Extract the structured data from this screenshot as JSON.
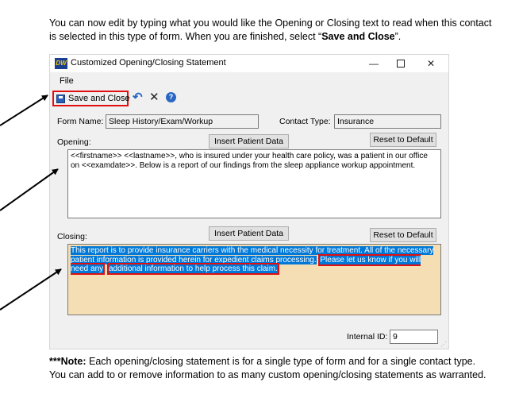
{
  "intro": {
    "part1": "You can now edit by typing what you would like the Opening or Closing text to read when this contact is selected in this type of form. When you are finished, select “",
    "bold": "Save and Close",
    "part2": "”."
  },
  "window": {
    "icon_text": "DW",
    "title": "Customized Opening/Closing Statement",
    "controls": {
      "minimize": "—",
      "close": "✕"
    }
  },
  "menu": {
    "file": "File"
  },
  "toolbar": {
    "save_label": "Save and Close",
    "icons": [
      "save-icon",
      "undo-icon",
      "cancel-icon",
      "help-icon"
    ]
  },
  "form": {
    "form_name_label": "Form Name:",
    "form_name_value": "Sleep History/Exam/Workup",
    "contact_type_label": "Contact Type:",
    "contact_type_value": "Insurance",
    "opening_label": "Opening:",
    "closing_label": "Closing:",
    "insert_patient_data": "Insert Patient Data",
    "reset_to_default": "Reset to Default",
    "opening_text": "<<firstname>> <<lastname>>, who is insured under your health care policy, was a patient in our office on <<examdate>>. Below is a report of our findings from the sleep appliance workup appointment.",
    "closing_text_part1": "This report is to provide insurance carriers with the medical necessity for treatment. All of the necessary patient information is provided herein for expedient claims processing.",
    "closing_text_highlight1": "Please let us know if you will need any",
    "closing_text_highlight2": "additional information to help process this claim.",
    "internal_id_label": "Internal ID:",
    "internal_id_value": "9"
  },
  "note": {
    "bold": "***Note:",
    "text": " Each opening/closing statement is for a single type of form and for a single contact type. You can add to or remove information to as many custom opening/closing statements as warranted."
  },
  "colors": {
    "highlight_red": "#e01010",
    "selection_blue": "#0078d7",
    "closing_bg": "#f5deb3"
  }
}
